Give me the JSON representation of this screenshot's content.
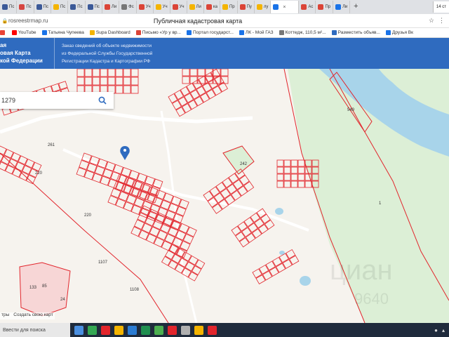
{
  "browser": {
    "tabs": [
      {
        "label": "Пс",
        "color": "#3b5998"
      },
      {
        "label": "Пс",
        "color": "#d64541"
      },
      {
        "label": "Пс",
        "color": "#3b5998"
      },
      {
        "label": "Пс",
        "color": "#f4b400"
      },
      {
        "label": "Пс",
        "color": "#3b5998"
      },
      {
        "label": "Пс",
        "color": "#3b5998"
      },
      {
        "label": "Ли",
        "color": "#db4437"
      },
      {
        "label": "Фс",
        "color": "#777777"
      },
      {
        "label": "Уч",
        "color": "#db4437"
      },
      {
        "label": "Уч",
        "color": "#f4b400"
      },
      {
        "label": "Уч",
        "color": "#db4437"
      },
      {
        "label": "Ли",
        "color": "#f4b400"
      },
      {
        "label": "ка",
        "color": "#db4437"
      },
      {
        "label": "Пр",
        "color": "#f4b400"
      },
      {
        "label": "Пу",
        "color": "#db4437"
      },
      {
        "label": "лу",
        "color": "#f4b400"
      },
      {
        "label": "",
        "color": "#1a73e8",
        "active": true
      },
      {
        "label": "Ac",
        "color": "#db4437"
      },
      {
        "label": "Пр",
        "color": "#db4437"
      },
      {
        "label": "Ли",
        "color": "#1a73e8"
      }
    ],
    "tab_close": "×",
    "new_tab": "+",
    "tray_date": "14 ст",
    "url": "rosreestrmap.ru",
    "page_title": "Публичная кадастровая карта",
    "bookmarks": [
      {
        "label": "",
        "color": "#ea4335"
      },
      {
        "label": "YouTube",
        "color": "#ff0000"
      },
      {
        "label": "Татьяна Чупеева",
        "color": "#1a73e8"
      },
      {
        "label": "Supa Dashboard",
        "color": "#f4b400"
      },
      {
        "label": "Письмо «Ур у вр...",
        "color": "#db4437"
      },
      {
        "label": "Портал государст...",
        "color": "#1a73e8"
      },
      {
        "label": "ЛК - Мой ГАЗ",
        "color": "#1a73e8"
      },
      {
        "label": "Коттедж, 110,5 м²...",
        "color": "#777777"
      },
      {
        "label": "Разместить объяв...",
        "color": "#2f6bbf"
      },
      {
        "label": "Друзья Вк",
        "color": "#1a73e8"
      }
    ]
  },
  "site": {
    "logo_line1": "ая",
    "logo_line2": "овая Карта",
    "logo_line3": "кой Федерации",
    "sub_line1": "Заказ сведений об объекте недвижимости",
    "sub_line2": "из Федеральной Службы Государственной",
    "sub_line3": "Регистрации Кадастра и Картографии РФ"
  },
  "search": {
    "value": "1279"
  },
  "map": {
    "labels": [
      "261",
      "220",
      "220",
      "1107",
      "1108",
      "1",
      "242",
      "549",
      "133",
      "85",
      "24"
    ],
    "watermark": "циан",
    "watermark2": "9640"
  },
  "bottom": {
    "link1": "тры",
    "link2": "Создать свою карт"
  },
  "taskbar": {
    "search_placeholder": "Ввести для поиска"
  },
  "colors": {
    "header": "#2f6bbf",
    "parcel": "#e2252c",
    "river": "#a8d4ea",
    "green": "#dcefd6"
  }
}
